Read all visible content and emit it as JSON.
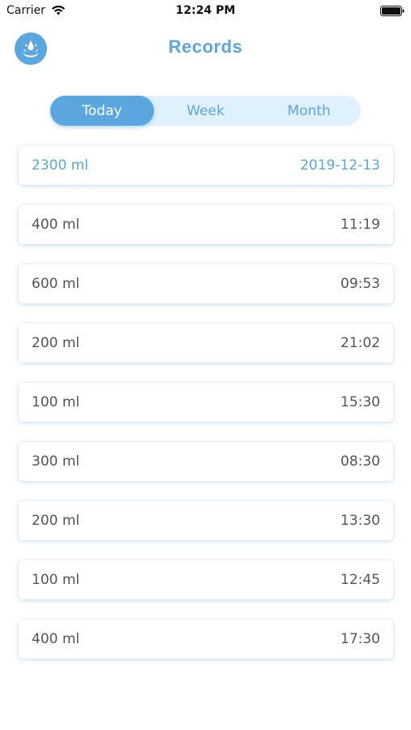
{
  "status_bar": {
    "carrier": "Carrier",
    "time": "12:24 PM"
  },
  "header": {
    "title": "Records",
    "logo_icon": "water-splash-icon"
  },
  "tabs": [
    {
      "label": "Today",
      "active": true
    },
    {
      "label": "Week",
      "active": false
    },
    {
      "label": "Month",
      "active": false
    }
  ],
  "summary": {
    "amount": "2300 ml",
    "date": "2019-12-13"
  },
  "records": [
    {
      "amount": "400 ml",
      "time": "11:19"
    },
    {
      "amount": "600 ml",
      "time": "09:53"
    },
    {
      "amount": "200 ml",
      "time": "21:02"
    },
    {
      "amount": "100 ml",
      "time": "15:30"
    },
    {
      "amount": "300 ml",
      "time": "08:30"
    },
    {
      "amount": "200 ml",
      "time": "13:30"
    },
    {
      "amount": "100 ml",
      "time": "12:45"
    },
    {
      "amount": "400 ml",
      "time": "17:30"
    }
  ],
  "colors": {
    "accent": "#5ba6de",
    "segment_bg": "#dff1fc",
    "text": "#555555"
  }
}
